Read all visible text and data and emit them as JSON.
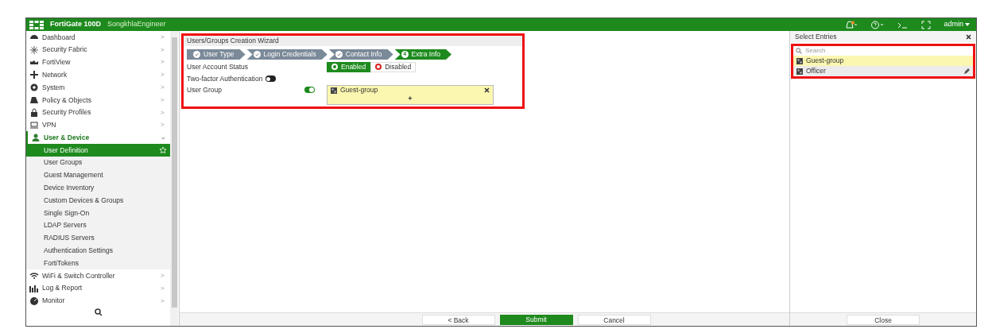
{
  "header": {
    "product": "FortiGate 100D",
    "hostname": "SongkhlaEngineer",
    "user": "admin"
  },
  "sidebar": {
    "items": [
      {
        "label": "Dashboard",
        "selected": false,
        "expanded": false,
        "arrow": ">"
      },
      {
        "label": "Security Fabric",
        "selected": false,
        "expanded": false,
        "arrow": ">"
      },
      {
        "label": "FortiView",
        "selected": false,
        "expanded": false,
        "arrow": ">"
      },
      {
        "label": "Network",
        "selected": false,
        "expanded": false,
        "arrow": ">"
      },
      {
        "label": "System",
        "selected": false,
        "expanded": false,
        "arrow": ">"
      },
      {
        "label": "Policy & Objects",
        "selected": false,
        "expanded": false,
        "arrow": ">"
      },
      {
        "label": "Security Profiles",
        "selected": false,
        "expanded": false,
        "arrow": ">"
      },
      {
        "label": "VPN",
        "selected": false,
        "expanded": false,
        "arrow": ">"
      },
      {
        "label": "User & Device",
        "selected": false,
        "expanded": true,
        "arrow": "⌄",
        "children": [
          {
            "label": "User Definition",
            "selected": true
          },
          {
            "label": "User Groups",
            "selected": false
          },
          {
            "label": "Guest Management",
            "selected": false
          },
          {
            "label": "Device Inventory",
            "selected": false
          },
          {
            "label": "Custom Devices & Groups",
            "selected": false
          },
          {
            "label": "Single Sign-On",
            "selected": false
          },
          {
            "label": "LDAP Servers",
            "selected": false
          },
          {
            "label": "RADIUS Servers",
            "selected": false
          },
          {
            "label": "Authentication Settings",
            "selected": false
          },
          {
            "label": "FortiTokens",
            "selected": false
          }
        ]
      },
      {
        "label": "WiFi & Switch Controller",
        "selected": false,
        "expanded": false,
        "arrow": ">"
      },
      {
        "label": "Log & Report",
        "selected": false,
        "expanded": false,
        "arrow": ">"
      },
      {
        "label": "Monitor",
        "selected": false,
        "expanded": false,
        "arrow": ">"
      }
    ]
  },
  "wizard": {
    "title": "Users/Groups Creation Wizard",
    "steps": [
      {
        "label": "User Type",
        "selected": false
      },
      {
        "label": "Login Credentials",
        "selected": false
      },
      {
        "label": "Contact Info",
        "selected": false
      },
      {
        "label": "Extra Info",
        "marker": "4",
        "selected": true
      }
    ],
    "status": {
      "label": "User Account Status",
      "options": [
        {
          "label": "Enabled",
          "selected": true
        },
        {
          "label": "Disabled",
          "selected": false
        }
      ]
    },
    "two_factor": {
      "label": "Two-factor Authentication",
      "on": false
    },
    "user_group": {
      "label": "User Group",
      "on": true,
      "entries": [
        "Guest-group"
      ],
      "add": "+"
    }
  },
  "select_entries": {
    "title": "Select Entries",
    "search_placeholder": "Search",
    "entries": [
      {
        "label": "Guest-group",
        "selected": true
      },
      {
        "label": "Officer",
        "selected": false
      }
    ]
  },
  "buttons": {
    "back": "< Back",
    "submit": "Submit",
    "cancel": "Cancel",
    "close": "Close"
  }
}
